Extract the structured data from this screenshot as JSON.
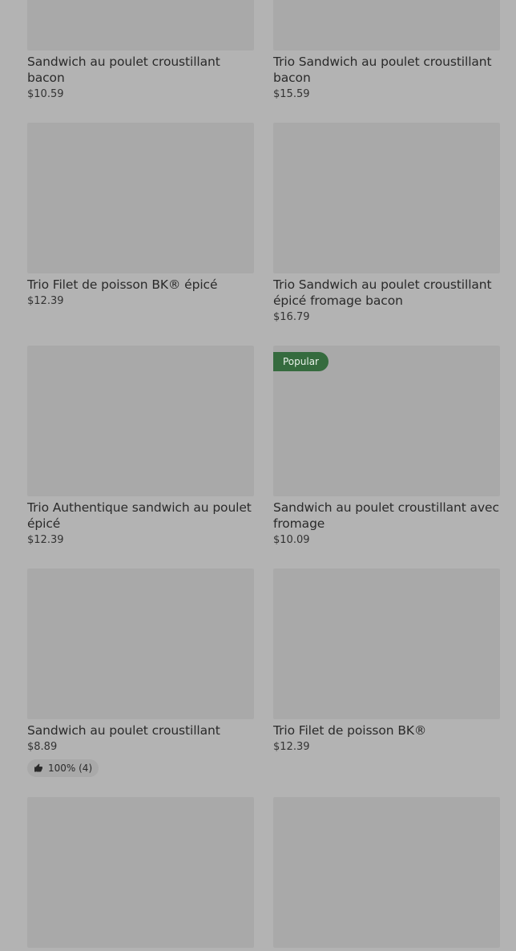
{
  "items": [
    {
      "title": "Sandwich au poulet croustillant bacon",
      "price": "$10.59"
    },
    {
      "title": "Trio Sandwich au poulet croustillant bacon",
      "price": "$15.59"
    },
    {
      "title": "Trio Filet de poisson BK® épicé",
      "price": "$12.39"
    },
    {
      "title": "Trio Sandwich au poulet croustillant épicé fromage bacon",
      "price": "$16.79"
    },
    {
      "title": "Trio Authentique sandwich au poulet épicé",
      "price": "$12.39"
    },
    {
      "title": "Sandwich au poulet croustillant avec fromage",
      "price": "$10.09",
      "badge": "Popular"
    },
    {
      "title": "Sandwich au poulet croustillant",
      "price": "$8.89",
      "rating": "100% (4)"
    },
    {
      "title": "Trio Filet de poisson BK®",
      "price": "$12.39"
    },
    {
      "title": "",
      "price": ""
    },
    {
      "title": "",
      "price": ""
    }
  ],
  "icons": {
    "rating_icon": "thumbs-up-icon"
  }
}
